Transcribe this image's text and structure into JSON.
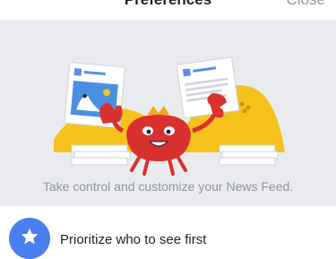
{
  "header": {
    "title": "Preferences",
    "close_label": "Close"
  },
  "hero": {
    "description": "Take control and customize your News Feed."
  },
  "options": [
    {
      "label": "Prioritize who to see first",
      "icon": "star-icon"
    }
  ],
  "colors": {
    "hero_bg": "#e9ebee",
    "accent_blue": "#4a7ff0",
    "crab_red": "#d9322e",
    "sand_yellow": "#f4c21b"
  }
}
